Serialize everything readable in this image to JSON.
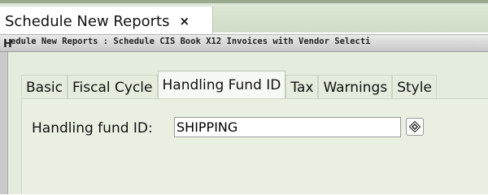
{
  "outer_tab": {
    "label": "Schedule New Reports",
    "close_glyph": "×"
  },
  "window": {
    "handle_glyph": "H",
    "title": "edule New Reports : Schedule CIS Book X12 Invoices with Vendor Selecti"
  },
  "tabs": [
    {
      "label": "Basic",
      "active": false
    },
    {
      "label": "Fiscal Cycle",
      "active": false
    },
    {
      "label": "Handling Fund ID",
      "active": true
    },
    {
      "label": "Tax",
      "active": false
    },
    {
      "label": "Warnings",
      "active": false
    },
    {
      "label": "Style",
      "active": false
    }
  ],
  "form": {
    "handling_fund_label": "Handling fund ID:",
    "handling_fund_value": "SHIPPING",
    "lookup_icon": "lookup-diamond-icon"
  }
}
